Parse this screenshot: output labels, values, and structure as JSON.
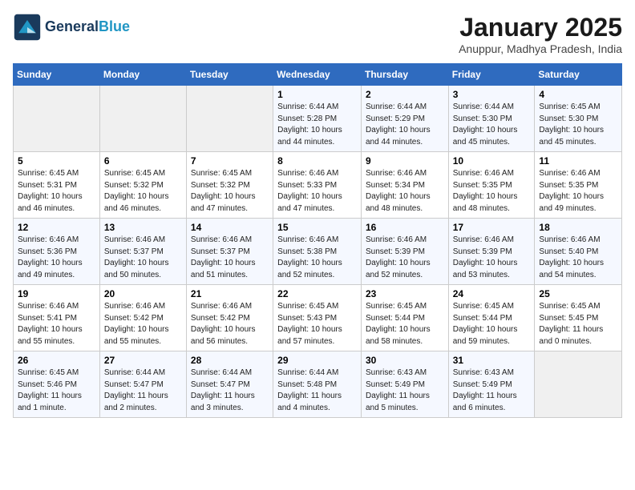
{
  "header": {
    "logo_line1": "General",
    "logo_line2": "Blue",
    "month_title": "January 2025",
    "location": "Anuppur, Madhya Pradesh, India"
  },
  "days_of_week": [
    "Sunday",
    "Monday",
    "Tuesday",
    "Wednesday",
    "Thursday",
    "Friday",
    "Saturday"
  ],
  "weeks": [
    [
      {
        "day": "",
        "sunrise": "",
        "sunset": "",
        "daylight": ""
      },
      {
        "day": "",
        "sunrise": "",
        "sunset": "",
        "daylight": ""
      },
      {
        "day": "",
        "sunrise": "",
        "sunset": "",
        "daylight": ""
      },
      {
        "day": "1",
        "sunrise": "Sunrise: 6:44 AM",
        "sunset": "Sunset: 5:28 PM",
        "daylight": "Daylight: 10 hours and 44 minutes."
      },
      {
        "day": "2",
        "sunrise": "Sunrise: 6:44 AM",
        "sunset": "Sunset: 5:29 PM",
        "daylight": "Daylight: 10 hours and 44 minutes."
      },
      {
        "day": "3",
        "sunrise": "Sunrise: 6:44 AM",
        "sunset": "Sunset: 5:30 PM",
        "daylight": "Daylight: 10 hours and 45 minutes."
      },
      {
        "day": "4",
        "sunrise": "Sunrise: 6:45 AM",
        "sunset": "Sunset: 5:30 PM",
        "daylight": "Daylight: 10 hours and 45 minutes."
      }
    ],
    [
      {
        "day": "5",
        "sunrise": "Sunrise: 6:45 AM",
        "sunset": "Sunset: 5:31 PM",
        "daylight": "Daylight: 10 hours and 46 minutes."
      },
      {
        "day": "6",
        "sunrise": "Sunrise: 6:45 AM",
        "sunset": "Sunset: 5:32 PM",
        "daylight": "Daylight: 10 hours and 46 minutes."
      },
      {
        "day": "7",
        "sunrise": "Sunrise: 6:45 AM",
        "sunset": "Sunset: 5:32 PM",
        "daylight": "Daylight: 10 hours and 47 minutes."
      },
      {
        "day": "8",
        "sunrise": "Sunrise: 6:46 AM",
        "sunset": "Sunset: 5:33 PM",
        "daylight": "Daylight: 10 hours and 47 minutes."
      },
      {
        "day": "9",
        "sunrise": "Sunrise: 6:46 AM",
        "sunset": "Sunset: 5:34 PM",
        "daylight": "Daylight: 10 hours and 48 minutes."
      },
      {
        "day": "10",
        "sunrise": "Sunrise: 6:46 AM",
        "sunset": "Sunset: 5:35 PM",
        "daylight": "Daylight: 10 hours and 48 minutes."
      },
      {
        "day": "11",
        "sunrise": "Sunrise: 6:46 AM",
        "sunset": "Sunset: 5:35 PM",
        "daylight": "Daylight: 10 hours and 49 minutes."
      }
    ],
    [
      {
        "day": "12",
        "sunrise": "Sunrise: 6:46 AM",
        "sunset": "Sunset: 5:36 PM",
        "daylight": "Daylight: 10 hours and 49 minutes."
      },
      {
        "day": "13",
        "sunrise": "Sunrise: 6:46 AM",
        "sunset": "Sunset: 5:37 PM",
        "daylight": "Daylight: 10 hours and 50 minutes."
      },
      {
        "day": "14",
        "sunrise": "Sunrise: 6:46 AM",
        "sunset": "Sunset: 5:37 PM",
        "daylight": "Daylight: 10 hours and 51 minutes."
      },
      {
        "day": "15",
        "sunrise": "Sunrise: 6:46 AM",
        "sunset": "Sunset: 5:38 PM",
        "daylight": "Daylight: 10 hours and 52 minutes."
      },
      {
        "day": "16",
        "sunrise": "Sunrise: 6:46 AM",
        "sunset": "Sunset: 5:39 PM",
        "daylight": "Daylight: 10 hours and 52 minutes."
      },
      {
        "day": "17",
        "sunrise": "Sunrise: 6:46 AM",
        "sunset": "Sunset: 5:39 PM",
        "daylight": "Daylight: 10 hours and 53 minutes."
      },
      {
        "day": "18",
        "sunrise": "Sunrise: 6:46 AM",
        "sunset": "Sunset: 5:40 PM",
        "daylight": "Daylight: 10 hours and 54 minutes."
      }
    ],
    [
      {
        "day": "19",
        "sunrise": "Sunrise: 6:46 AM",
        "sunset": "Sunset: 5:41 PM",
        "daylight": "Daylight: 10 hours and 55 minutes."
      },
      {
        "day": "20",
        "sunrise": "Sunrise: 6:46 AM",
        "sunset": "Sunset: 5:42 PM",
        "daylight": "Daylight: 10 hours and 55 minutes."
      },
      {
        "day": "21",
        "sunrise": "Sunrise: 6:46 AM",
        "sunset": "Sunset: 5:42 PM",
        "daylight": "Daylight: 10 hours and 56 minutes."
      },
      {
        "day": "22",
        "sunrise": "Sunrise: 6:45 AM",
        "sunset": "Sunset: 5:43 PM",
        "daylight": "Daylight: 10 hours and 57 minutes."
      },
      {
        "day": "23",
        "sunrise": "Sunrise: 6:45 AM",
        "sunset": "Sunset: 5:44 PM",
        "daylight": "Daylight: 10 hours and 58 minutes."
      },
      {
        "day": "24",
        "sunrise": "Sunrise: 6:45 AM",
        "sunset": "Sunset: 5:44 PM",
        "daylight": "Daylight: 10 hours and 59 minutes."
      },
      {
        "day": "25",
        "sunrise": "Sunrise: 6:45 AM",
        "sunset": "Sunset: 5:45 PM",
        "daylight": "Daylight: 11 hours and 0 minutes."
      }
    ],
    [
      {
        "day": "26",
        "sunrise": "Sunrise: 6:45 AM",
        "sunset": "Sunset: 5:46 PM",
        "daylight": "Daylight: 11 hours and 1 minute."
      },
      {
        "day": "27",
        "sunrise": "Sunrise: 6:44 AM",
        "sunset": "Sunset: 5:47 PM",
        "daylight": "Daylight: 11 hours and 2 minutes."
      },
      {
        "day": "28",
        "sunrise": "Sunrise: 6:44 AM",
        "sunset": "Sunset: 5:47 PM",
        "daylight": "Daylight: 11 hours and 3 minutes."
      },
      {
        "day": "29",
        "sunrise": "Sunrise: 6:44 AM",
        "sunset": "Sunset: 5:48 PM",
        "daylight": "Daylight: 11 hours and 4 minutes."
      },
      {
        "day": "30",
        "sunrise": "Sunrise: 6:43 AM",
        "sunset": "Sunset: 5:49 PM",
        "daylight": "Daylight: 11 hours and 5 minutes."
      },
      {
        "day": "31",
        "sunrise": "Sunrise: 6:43 AM",
        "sunset": "Sunset: 5:49 PM",
        "daylight": "Daylight: 11 hours and 6 minutes."
      },
      {
        "day": "",
        "sunrise": "",
        "sunset": "",
        "daylight": ""
      }
    ]
  ]
}
